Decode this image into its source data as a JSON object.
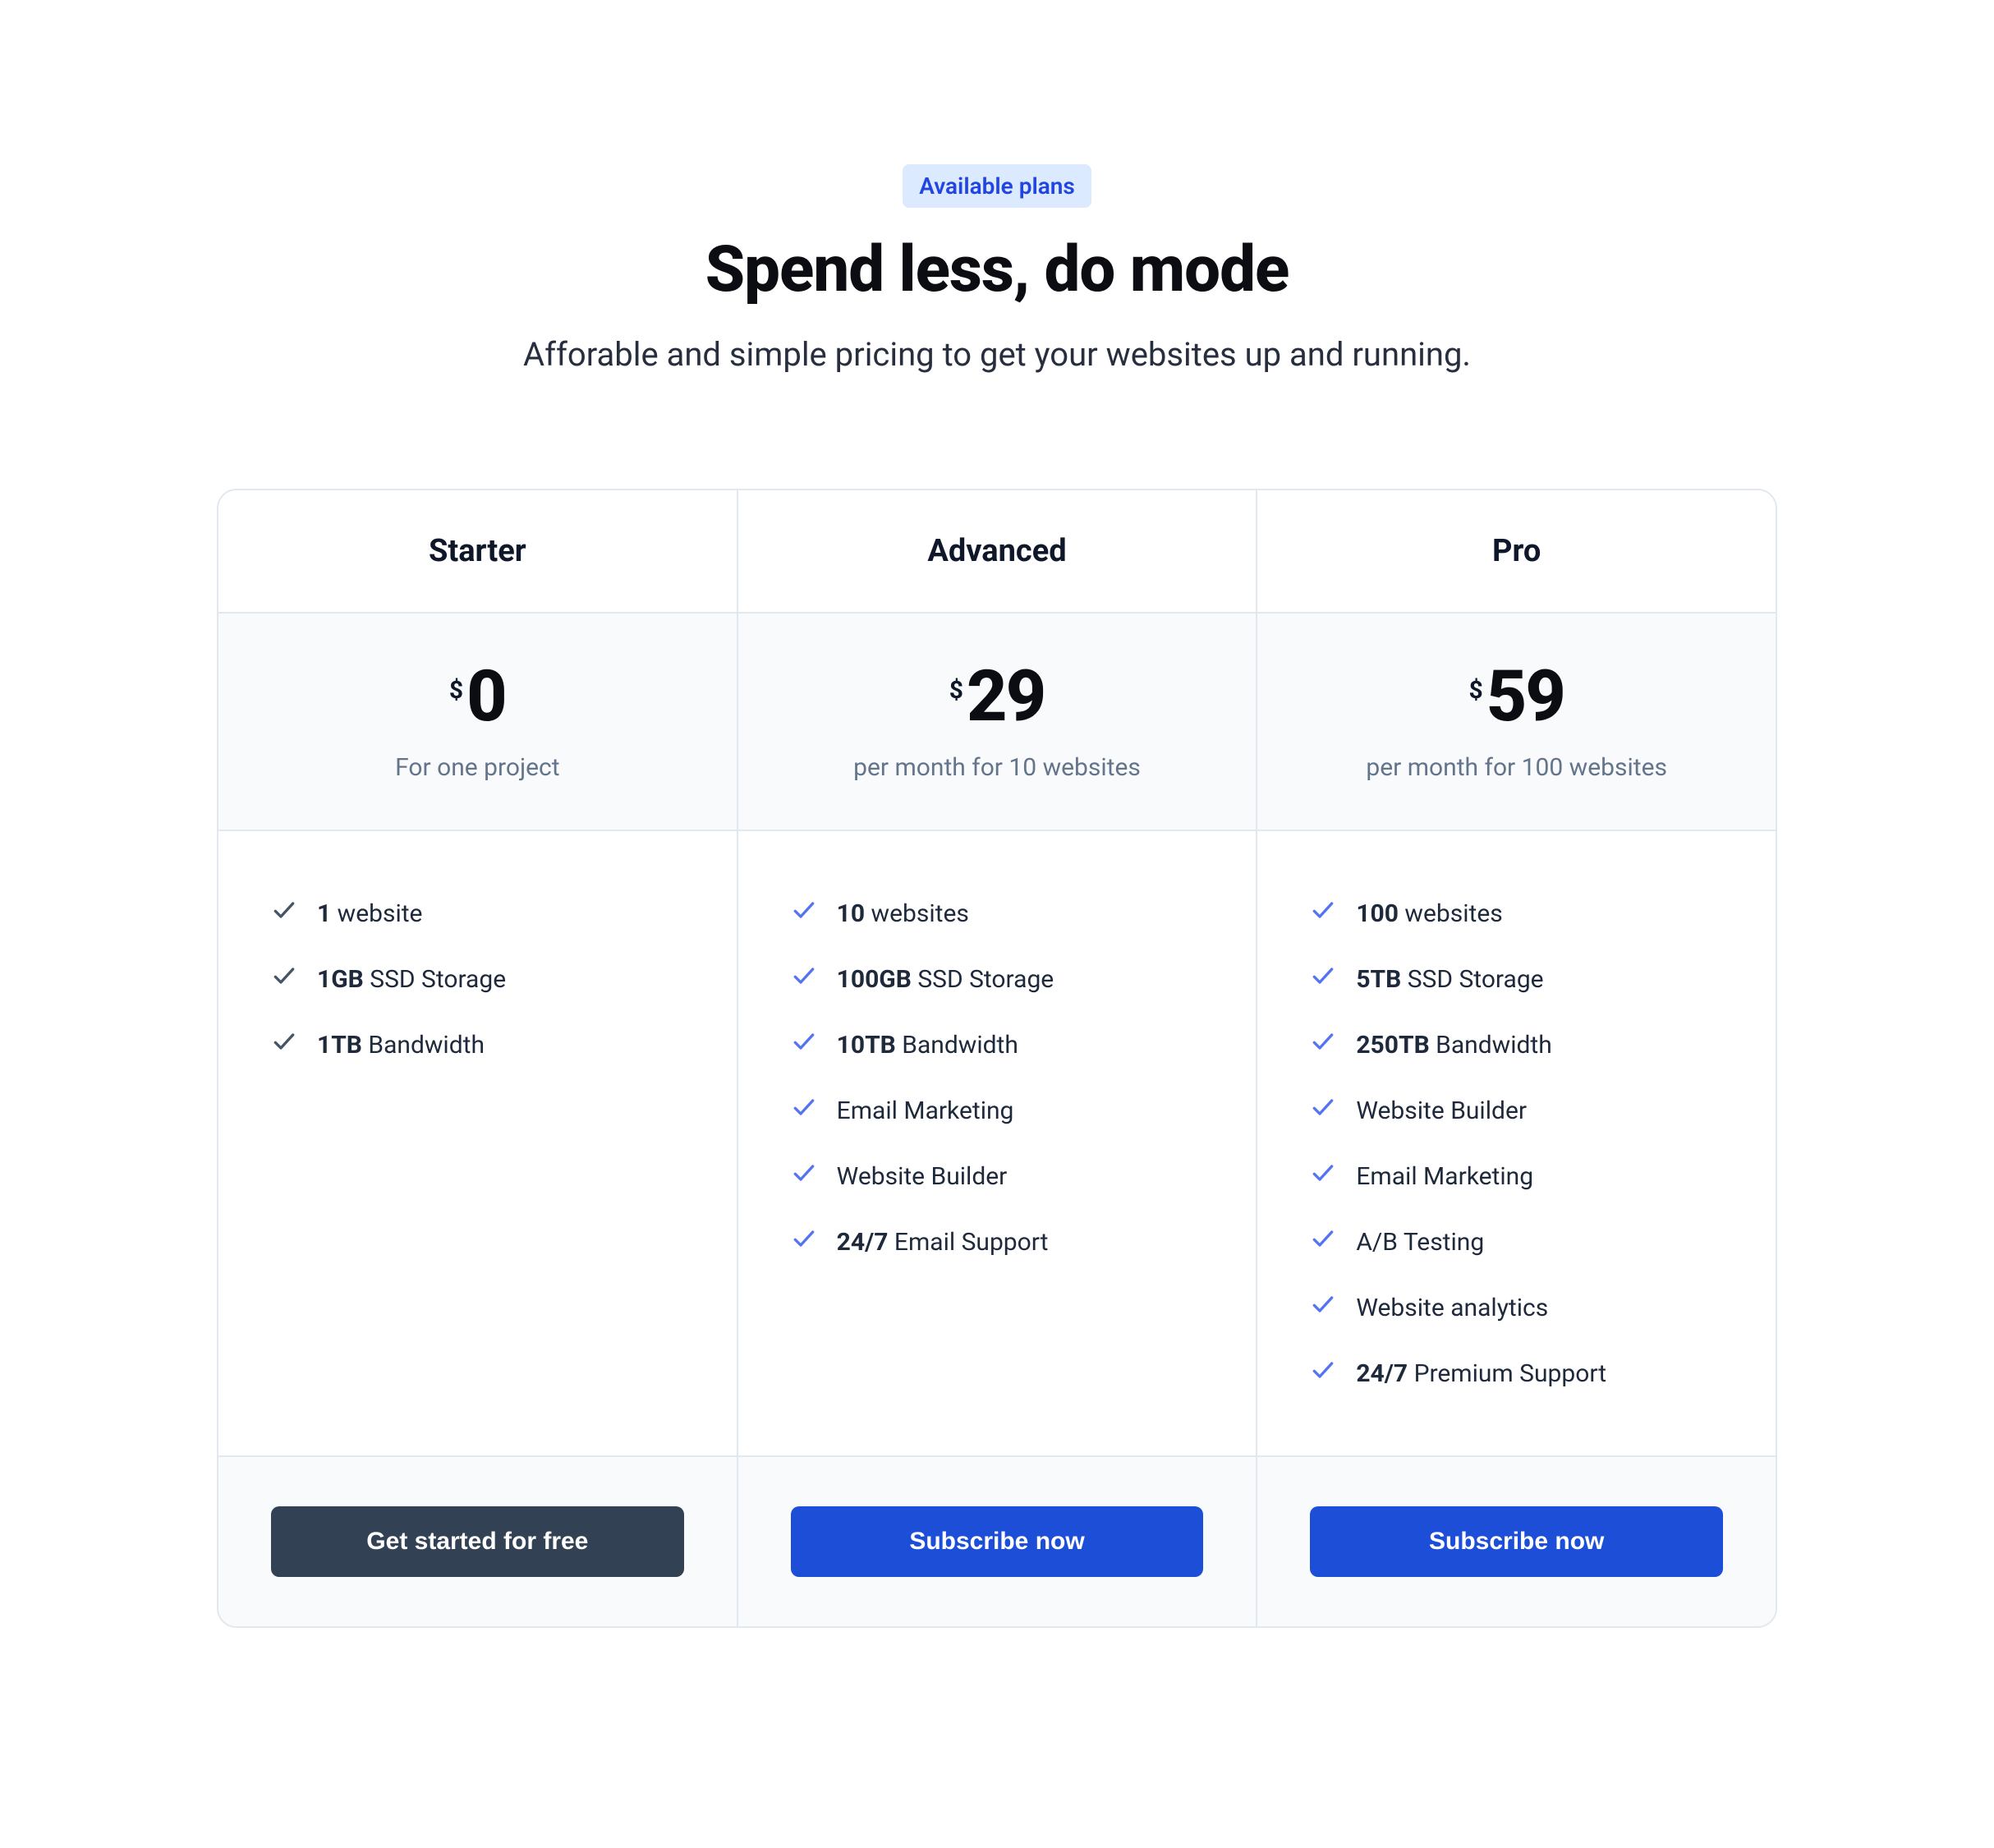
{
  "header": {
    "badge": "Available plans",
    "title": "Spend less, do mode",
    "subtitle": "Afforable and simple pricing to get your websites up and running."
  },
  "colors": {
    "primary": "#1d4ed8",
    "dark_button": "#334155",
    "badge_bg": "#dbeafe",
    "badge_text": "#2244e0",
    "check_muted": "#475569",
    "check_accent": "#5574f2"
  },
  "plans": [
    {
      "name": "Starter",
      "currency": "$",
      "amount": "0",
      "price_desc": "For one project",
      "check_color": "#475569",
      "features": [
        {
          "bold": "1",
          "rest": " website"
        },
        {
          "bold": "1GB",
          "rest": " SSD Storage"
        },
        {
          "bold": "1TB",
          "rest": " Bandwidth"
        }
      ],
      "cta": {
        "label": "Get started for free",
        "style": "dark"
      }
    },
    {
      "name": "Advanced",
      "currency": "$",
      "amount": "29",
      "price_desc": "per month for 10 websites",
      "check_color": "#5574f2",
      "features": [
        {
          "bold": "10",
          "rest": " websites"
        },
        {
          "bold": "100GB",
          "rest": " SSD Storage"
        },
        {
          "bold": "10TB",
          "rest": " Bandwidth"
        },
        {
          "bold": "",
          "rest": "Email Marketing"
        },
        {
          "bold": "",
          "rest": "Website Builder"
        },
        {
          "bold": "24/7",
          "rest": " Email Support"
        }
      ],
      "cta": {
        "label": "Subscribe now",
        "style": "primary"
      }
    },
    {
      "name": "Pro",
      "currency": "$",
      "amount": "59",
      "price_desc": "per month for 100 websites",
      "check_color": "#5574f2",
      "features": [
        {
          "bold": "100",
          "rest": " websites"
        },
        {
          "bold": "5TB",
          "rest": " SSD Storage"
        },
        {
          "bold": "250TB",
          "rest": " Bandwidth"
        },
        {
          "bold": "",
          "rest": "Website Builder"
        },
        {
          "bold": "",
          "rest": "Email Marketing"
        },
        {
          "bold": "",
          "rest": "A/B Testing"
        },
        {
          "bold": "",
          "rest": "Website analytics"
        },
        {
          "bold": "24/7",
          "rest": " Premium Support"
        }
      ],
      "cta": {
        "label": "Subscribe now",
        "style": "primary"
      }
    }
  ]
}
